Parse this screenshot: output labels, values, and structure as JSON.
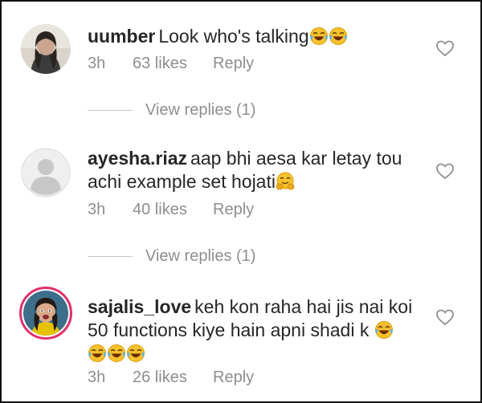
{
  "comments": [
    {
      "username": "uumber",
      "text": "Look who's talking",
      "trailing_emojis": [
        "joy-emoji",
        "joy-emoji"
      ],
      "time": "3h",
      "likes": "63 likes",
      "reply_label": "Reply",
      "view_replies": "View replies (1)"
    },
    {
      "username": "ayesha.riaz",
      "text": "aap bhi aesa kar letay tou achi example set hojati",
      "trailing_emojis": [
        "hugging-emoji"
      ],
      "time": "3h",
      "likes": "40 likes",
      "reply_label": "Reply",
      "view_replies": "View replies (1)"
    },
    {
      "username": "sajalis_love",
      "text": "keh kon raha hai jis nai koi 50 functions kiye hain apni shadi k",
      "trailing_emojis": [
        "joy-emoji",
        "joy-emoji",
        "joy-emoji",
        "joy-emoji"
      ],
      "time": "3h",
      "likes": "26 likes",
      "reply_label": "Reply"
    }
  ],
  "colors": {
    "text": "#262626",
    "secondary": "#8e8e8e",
    "story_ring": "#e1306c"
  }
}
